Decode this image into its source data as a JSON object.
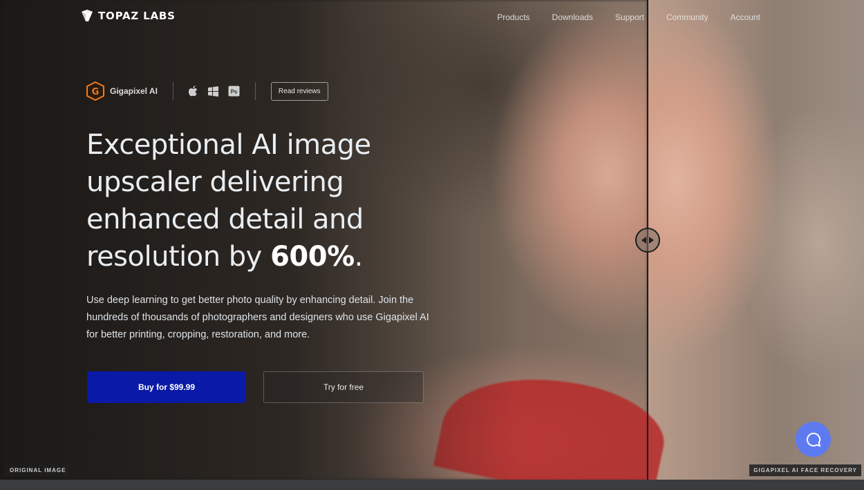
{
  "brand": {
    "name": "TOPAZ LABS"
  },
  "nav": [
    "Products",
    "Downloads",
    "Support",
    "Community",
    "Account"
  ],
  "product": {
    "name": "Gigapixel AI",
    "icon_letter": "G",
    "platforms": [
      "apple-icon",
      "windows-icon",
      "photoshop-icon"
    ],
    "photoshop_label": "Ps",
    "reviews_button": "Read reviews"
  },
  "hero": {
    "headline_part1": "Exceptional AI image upscaler delivering enhanced detail and resolution by ",
    "headline_emph": "600%",
    "headline_end": ".",
    "description": "Use deep learning to get better photo quality by enhancing detail. Join the hundreds of thousands of photographers and designers who use Gigapixel AI for better printing, cropping, restoration, and more.",
    "buy_button": "Buy for $99.99",
    "try_button": "Try for free"
  },
  "comparison": {
    "left_label": "ORIGINAL IMAGE",
    "right_label": "GIGAPIXEL AI FACE RECOVERY"
  },
  "colors": {
    "buy": "#0a1aa6",
    "chat": "#5e7af0",
    "brand_orange": "#f07b1d"
  }
}
